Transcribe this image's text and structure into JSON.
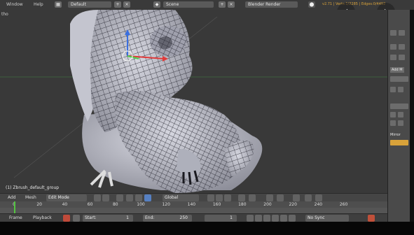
{
  "topbar": {
    "menu_window": "Window",
    "menu_help": "Help",
    "layout_value": "Default",
    "scene_value": "Scene",
    "render_engine": "Blender Render",
    "stats": "v2.71 | Verts:1/2285 | Edges:0/4492"
  },
  "viewport": {
    "label": "tho",
    "object_name": "(1) Zbrush_default_group"
  },
  "header": {
    "menu_add": "Add",
    "menu_mesh": "Mesh",
    "mode_value": "Edit Mode",
    "orientation_value": "Global"
  },
  "timeline": {
    "ticks": [
      "0",
      "20",
      "40",
      "60",
      "80",
      "100",
      "120",
      "140",
      "160",
      "180",
      "200",
      "220",
      "240",
      "260"
    ],
    "current_frame": 0
  },
  "footer": {
    "frame_label": "Frame",
    "playback_label": "Playback",
    "start_label": "Start:",
    "start_value": "1",
    "end_label": "End:",
    "end_value": "250",
    "current_value": "1",
    "sync_value": "No Sync"
  },
  "panel": {
    "add_modifier_label": "Add M",
    "mirror_label": "Mirror"
  },
  "colors": {
    "accent": "#d8a23a",
    "playhead": "#53c540",
    "mesh": "#c8c9d2",
    "wire": "#161620"
  },
  "icons": [
    "chevron-left-icon",
    "chevron-right-icon",
    "record-icon",
    "close-icon",
    "dropdown-icon"
  ]
}
